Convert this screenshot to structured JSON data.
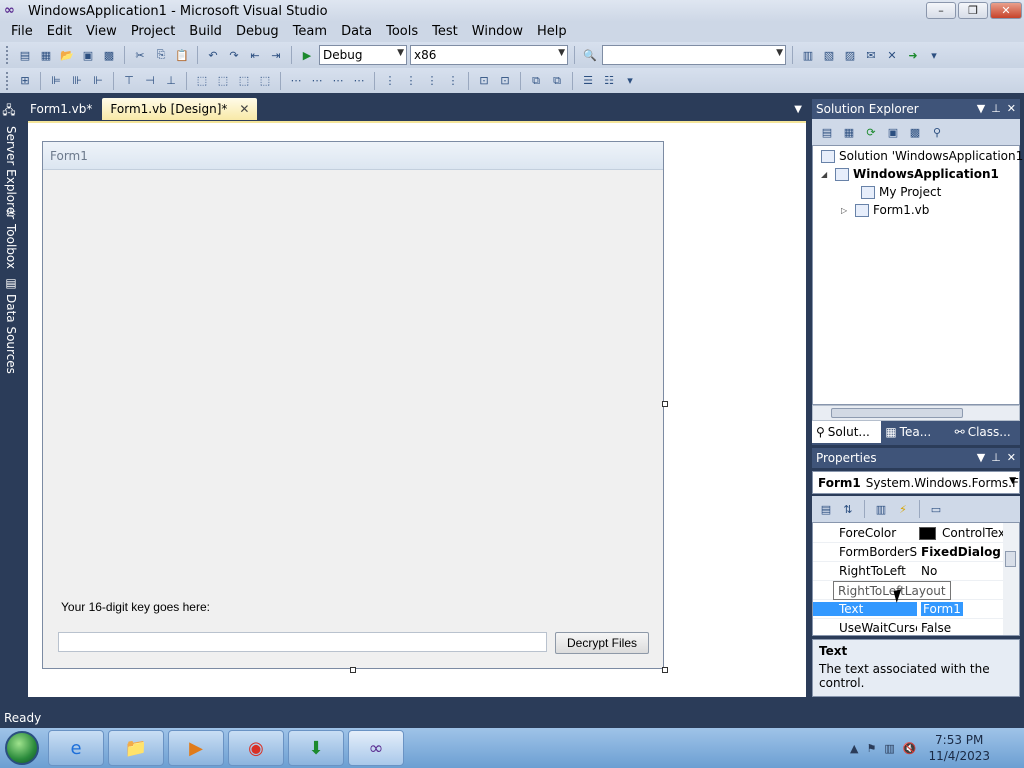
{
  "window": {
    "title": "WindowsApplication1 - Microsoft Visual Studio",
    "minimize": "–",
    "maximize": "❐",
    "close": "✕"
  },
  "menu": [
    "File",
    "Edit",
    "View",
    "Project",
    "Build",
    "Debug",
    "Team",
    "Data",
    "Tools",
    "Test",
    "Window",
    "Help"
  ],
  "toolbar": {
    "config": "Debug",
    "platform": "x86",
    "search": ""
  },
  "side_tabs": [
    "Server Explorer",
    "Toolbox",
    "Data Sources"
  ],
  "doc_tabs": [
    {
      "label": "Form1.vb*"
    },
    {
      "label": "Form1.vb [Design]*",
      "close": "✕"
    }
  ],
  "form": {
    "title": "Form1",
    "label": "Your 16-digit key goes here:",
    "input_value": "",
    "button": "Decrypt Files"
  },
  "solution_explorer": {
    "title": "Solution Explorer",
    "tree": {
      "solution": "Solution 'WindowsApplication1'",
      "project": "WindowsApplication1",
      "my_project": "My Project",
      "form": "Form1.vb"
    },
    "tabs": [
      "Solut...",
      "Tea...",
      "Class..."
    ]
  },
  "properties": {
    "title": "Properties",
    "object_name": "Form1",
    "object_type": "System.Windows.Forms.Fo",
    "rows": [
      {
        "name": "ForeColor",
        "value": "ControlTex"
      },
      {
        "name": "FormBorderSt",
        "value": "FixedDialog"
      },
      {
        "name": "RightToLeft",
        "value": "No"
      },
      {
        "name": "RightToLeftLayout",
        "value": ""
      },
      {
        "name": "Text",
        "value": "Form1"
      },
      {
        "name": "UseWaitCursc",
        "value": "False"
      }
    ],
    "tooltip": "RightToLeftLayout",
    "desc_title": "Text",
    "desc_body": "The text associated with the control."
  },
  "status": "Ready",
  "clock": {
    "time": "7:53 PM",
    "date": "11/4/2023"
  }
}
